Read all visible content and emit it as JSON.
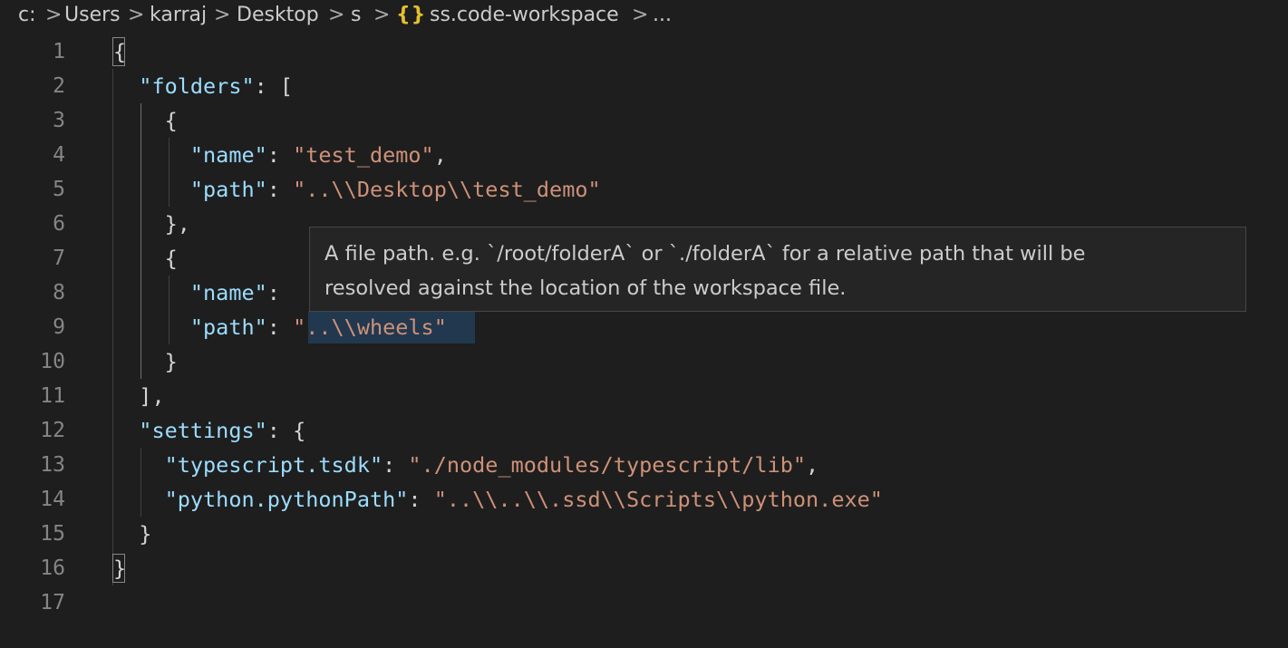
{
  "breadcrumb": {
    "items": [
      "c:",
      "Users",
      "karraj",
      "Desktop",
      "s",
      "ss.code-workspace",
      "..."
    ],
    "separator": ">",
    "file_icon": "{}"
  },
  "editor": {
    "lines": [
      {
        "number": "1",
        "tokens": [
          {
            "t": "p",
            "v": "{"
          }
        ]
      },
      {
        "number": "2",
        "tokens": [
          {
            "t": "p",
            "v": "  "
          },
          {
            "t": "k",
            "v": "\"folders\""
          },
          {
            "t": "p",
            "v": ": ["
          }
        ]
      },
      {
        "number": "3",
        "tokens": [
          {
            "t": "p",
            "v": "    {"
          }
        ]
      },
      {
        "number": "4",
        "tokens": [
          {
            "t": "p",
            "v": "      "
          },
          {
            "t": "k",
            "v": "\"name\""
          },
          {
            "t": "p",
            "v": ": "
          },
          {
            "t": "s",
            "v": "\"test_demo\""
          },
          {
            "t": "p",
            "v": ","
          }
        ]
      },
      {
        "number": "5",
        "tokens": [
          {
            "t": "p",
            "v": "      "
          },
          {
            "t": "k",
            "v": "\"path\""
          },
          {
            "t": "p",
            "v": ": "
          },
          {
            "t": "s",
            "v": "\"..\\\\Desktop\\\\test_demo\""
          }
        ]
      },
      {
        "number": "6",
        "tokens": [
          {
            "t": "p",
            "v": "    },"
          }
        ]
      },
      {
        "number": "7",
        "tokens": [
          {
            "t": "p",
            "v": "    {"
          }
        ]
      },
      {
        "number": "8",
        "tokens": [
          {
            "t": "p",
            "v": "      "
          },
          {
            "t": "k",
            "v": "\"name\""
          },
          {
            "t": "p",
            "v": ":"
          }
        ]
      },
      {
        "number": "9",
        "tokens": [
          {
            "t": "p",
            "v": "      "
          },
          {
            "t": "k",
            "v": "\"path\""
          },
          {
            "t": "p",
            "v": ": "
          },
          {
            "t": "s",
            "v": "\"..\\\\wheels\""
          }
        ]
      },
      {
        "number": "10",
        "tokens": [
          {
            "t": "p",
            "v": "    }"
          }
        ]
      },
      {
        "number": "11",
        "tokens": [
          {
            "t": "p",
            "v": "  ],"
          }
        ]
      },
      {
        "number": "12",
        "tokens": [
          {
            "t": "p",
            "v": "  "
          },
          {
            "t": "k",
            "v": "\"settings\""
          },
          {
            "t": "p",
            "v": ": {"
          }
        ]
      },
      {
        "number": "13",
        "tokens": [
          {
            "t": "p",
            "v": "    "
          },
          {
            "t": "k",
            "v": "\"typescript.tsdk\""
          },
          {
            "t": "p",
            "v": ": "
          },
          {
            "t": "s",
            "v": "\"./node_modules/typescript/lib\""
          },
          {
            "t": "p",
            "v": ","
          }
        ]
      },
      {
        "number": "14",
        "tokens": [
          {
            "t": "p",
            "v": "    "
          },
          {
            "t": "k",
            "v": "\"python.pythonPath\""
          },
          {
            "t": "p",
            "v": ": "
          },
          {
            "t": "s",
            "v": "\"..\\\\..\\\\.ssd\\\\Scripts\\\\python.exe\""
          }
        ]
      },
      {
        "number": "15",
        "tokens": [
          {
            "t": "p",
            "v": "  }"
          }
        ]
      },
      {
        "number": "16",
        "tokens": [
          {
            "t": "p",
            "v": "}"
          }
        ]
      },
      {
        "number": "17",
        "tokens": []
      }
    ]
  },
  "hover": {
    "line1": "A file path. e.g. `/root/folderA` or `./folderA` for a relative path that will be",
    "line2": "resolved against the location of the workspace file."
  },
  "colors": {
    "background": "#1e1e1e",
    "key": "#9cdcfe",
    "string": "#ce9178",
    "punctuation": "#d4d4d4",
    "line_number": "#858585",
    "json_icon": "#e2c02f"
  }
}
